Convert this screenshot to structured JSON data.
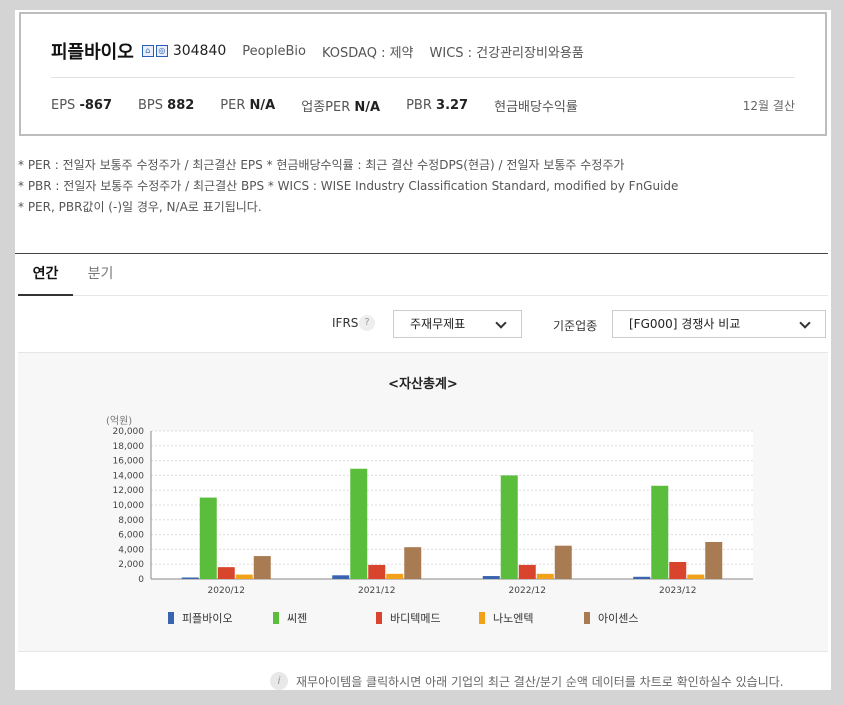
{
  "company": {
    "name": "피플바이오",
    "code": "304840",
    "name_en": "PeopleBio",
    "market": "KOSDAQ : 제약",
    "wics": "WICS : 건강관리장비와용품"
  },
  "stats": {
    "eps_label": "EPS",
    "eps_value": "-867",
    "bps_label": "BPS",
    "bps_value": "882",
    "per_label": "PER",
    "per_value": "N/A",
    "ind_per_label": "업종PER",
    "ind_per_value": "N/A",
    "pbr_label": "PBR",
    "pbr_value": "3.27",
    "dividend_label": "현금배당수익률",
    "settlement": "12월 결산"
  },
  "notes": [
    "* PER : 전일자 보통주 수정주가 / 최근결산 EPS * 현금배당수익률 : 최근 결산 수정DPS(현금) / 전일자 보통주 수정주가",
    "* PBR : 전일자 보통주 수정주가 / 최근결산 BPS * WICS : WISE Industry Classification Standard, modified by FnGuide",
    "* PER, PBR값이 (-)일 경우, N/A로 표기됩니다."
  ],
  "tabs": [
    {
      "label": "연간",
      "active": true
    },
    {
      "label": "분기",
      "active": false
    }
  ],
  "controls": {
    "ifrs_label": "IFRS",
    "help_glyph": "?",
    "statement_select": "주재무제표",
    "industry_label": "기준업종",
    "industry_select": "[FG000] 경쟁사 비교"
  },
  "chart_data": {
    "type": "bar",
    "title": "<자산총계>",
    "ylabel": "(억원)",
    "ylim": [
      0,
      20000
    ],
    "yticks": [
      "0",
      "2,000",
      "4,000",
      "6,000",
      "8,000",
      "10,000",
      "12,000",
      "14,000",
      "16,000",
      "18,000",
      "20,000"
    ],
    "categories": [
      "2020/12",
      "2021/12",
      "2022/12",
      "2023/12"
    ],
    "grid": true,
    "legend_position": "bottom",
    "series": [
      {
        "name": "피플바이오",
        "color": "#3a64b0",
        "values": [
          200,
          500,
          400,
          300
        ]
      },
      {
        "name": "씨젠",
        "color": "#5bbd3c",
        "values": [
          11000,
          14900,
          14000,
          12600
        ]
      },
      {
        "name": "바디텍메드",
        "color": "#d9442c",
        "values": [
          1600,
          1900,
          1900,
          2300
        ]
      },
      {
        "name": "나노엔텍",
        "color": "#f2a21a",
        "values": [
          600,
          700,
          700,
          600
        ]
      },
      {
        "name": "아이센스",
        "color": "#a87b52",
        "values": [
          3100,
          4300,
          4500,
          5000
        ]
      }
    ]
  },
  "info": {
    "icon_glyph": "i",
    "text": "재무아이템을 클릭하시면 아래 기업의 최근 결산/분기 순액 데이터를 차트로 확인하실수 있습니다."
  }
}
